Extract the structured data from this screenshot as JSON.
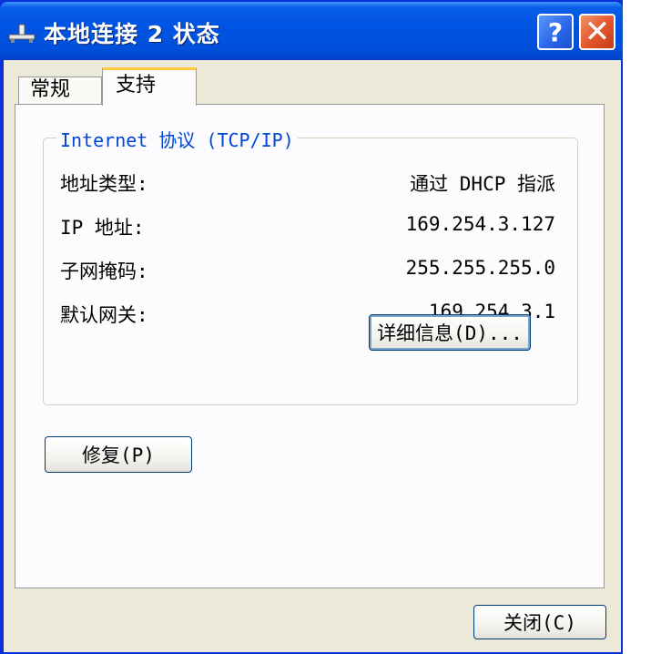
{
  "window": {
    "title": "本地连接 2 状态",
    "help_button": "?",
    "close_button": "✕"
  },
  "tabs": [
    {
      "label": "常规"
    },
    {
      "label": "支持"
    }
  ],
  "group": {
    "title": "Internet 协议 (TCP/IP)",
    "rows": [
      {
        "label": "地址类型:",
        "value": "通过 DHCP 指派"
      },
      {
        "label": "IP 地址:",
        "value": "169.254.3.127"
      },
      {
        "label": "子网掩码:",
        "value": "255.255.255.0"
      },
      {
        "label": "默认网关:",
        "value": "169.254.3.1"
      }
    ],
    "details_button": "详细信息(D)..."
  },
  "repair_button": "修复(P)",
  "close_dialog_button": "关闭(C)",
  "colors": {
    "title_blue": "#0054e3",
    "dialog_bg": "#ece9d8",
    "group_title": "#0046d5",
    "close_red": "#e2552b",
    "tab_highlight": "#ffc83c"
  }
}
